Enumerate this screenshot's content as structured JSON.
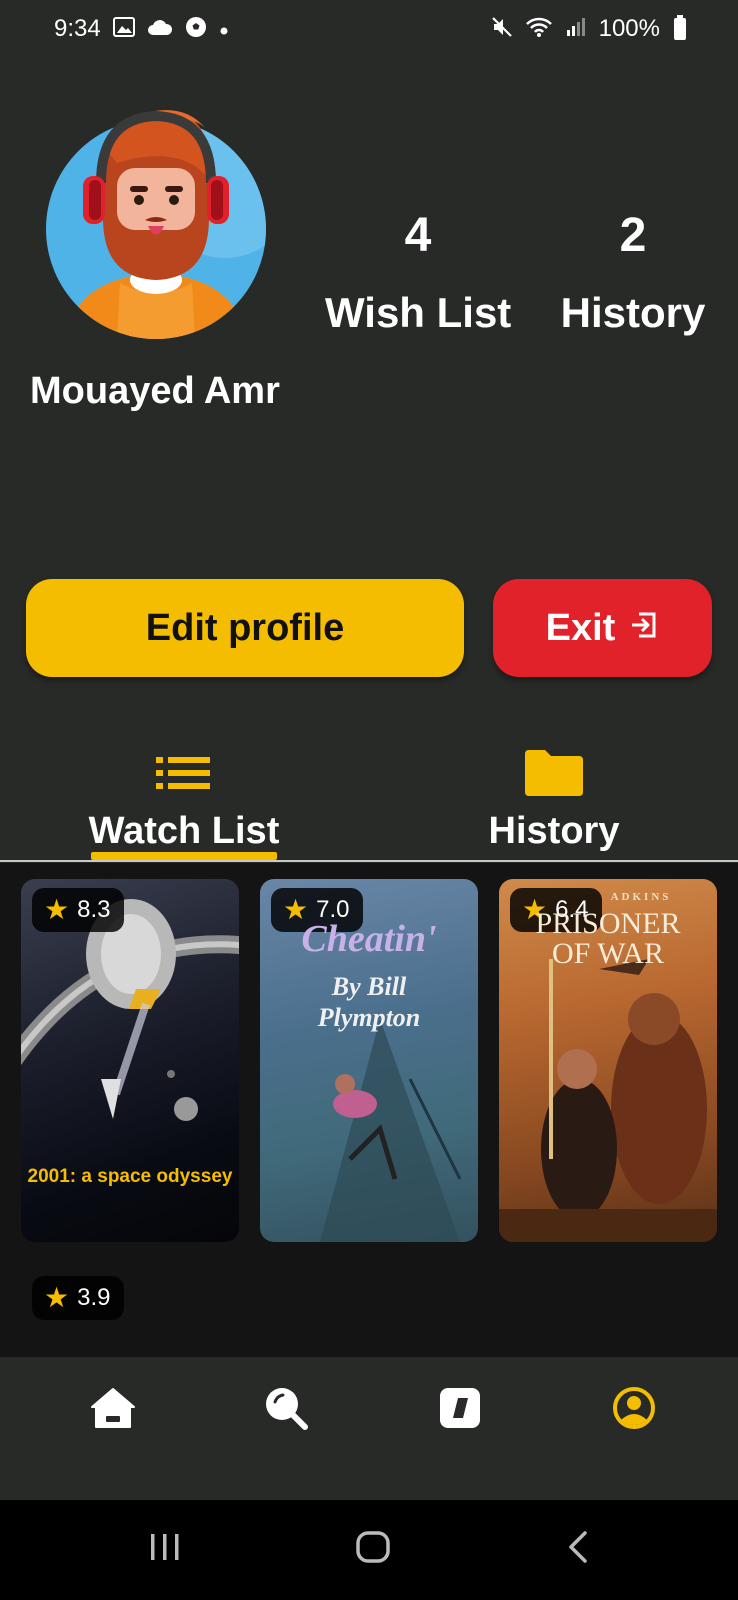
{
  "status_bar": {
    "time": "9:34",
    "battery": "100%",
    "left_icons": [
      "image-icon",
      "cloud-icon",
      "soccer-ball-icon",
      "dot-icon"
    ],
    "right_icons": [
      "mute-icon",
      "wifi-icon",
      "signal-icon",
      "battery-icon"
    ]
  },
  "profile": {
    "name": "Mouayed Amr",
    "wish_list_count": "4",
    "wish_list_label": "Wish List",
    "history_count": "2",
    "history_label": "History"
  },
  "buttons": {
    "edit_label": "Edit profile",
    "exit_label": "Exit"
  },
  "tabs": {
    "watch_list_label": "Watch List",
    "history_label": "History",
    "active": "watch_list"
  },
  "movies": [
    {
      "rating": "8.3",
      "poster_title": "2001: a space odyssey"
    },
    {
      "rating": "7.0",
      "poster_title": "Cheatin'",
      "poster_subtitle": "By Bill Plympton"
    },
    {
      "rating": "6.4",
      "poster_title": "PRISONER OF WAR",
      "poster_top": "ADKINS"
    },
    {
      "rating": "3.9"
    }
  ],
  "colors": {
    "accent": "#f5bd00",
    "exit": "#e1222a",
    "background": "#282a28",
    "content_background": "#141414"
  },
  "bottom_nav": {
    "items": [
      "home-icon",
      "search-icon",
      "browse-icon",
      "profile-icon"
    ],
    "active": "profile-icon"
  }
}
